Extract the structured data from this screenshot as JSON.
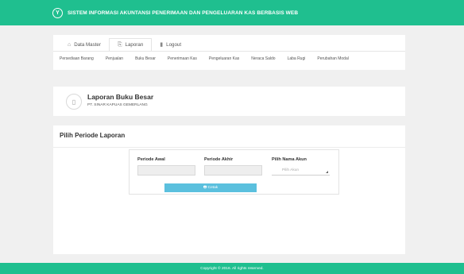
{
  "app": {
    "logo_glyph": "Y",
    "title": "SISTEM INFORMASI AKUNTANSI PENERIMAAN DAN PENGELUARAN KAS BERBASIS WEB"
  },
  "tabs": [
    {
      "label": "Data Master",
      "icon": "home-icon",
      "glyph": "⌂"
    },
    {
      "label": "Laporan",
      "icon": "file-icon",
      "glyph": "⎘"
    },
    {
      "label": "Logout",
      "icon": "chart-icon",
      "glyph": "▮"
    }
  ],
  "menu": [
    "Persediaan Barang",
    "Penjualan",
    "Buku Besar",
    "Penerimaan Kas",
    "Pengeluaran Kas",
    "Neraca Saldo",
    "Laba Rugi",
    "Perubahan Modal"
  ],
  "header": {
    "title": "Laporan Buku Besar",
    "subtitle": "PT. SINAR KAPUAS GEMERLANG",
    "icon_glyph": "▯"
  },
  "form": {
    "title": "Pilih Periode Laporan",
    "periode_awal_label": "Periode Awal",
    "periode_awal_value": "",
    "periode_akhir_label": "Periode Akhir",
    "periode_akhir_value": "",
    "akun_label": "Pilih Nama Akun",
    "akun_selected": "Pilih Akun",
    "cetak_label": "🖶 Cetak"
  },
  "footer": {
    "text": "Copyright © 2016. All rights reserved."
  },
  "colors": {
    "accent": "#1fbf8f",
    "button": "#5bc0de"
  }
}
